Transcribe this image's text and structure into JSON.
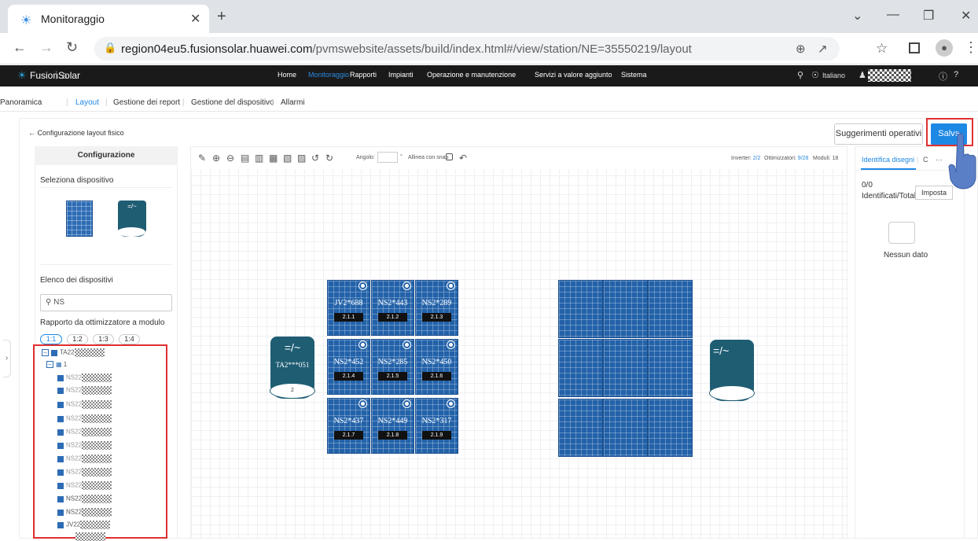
{
  "browser": {
    "tab_title": "Monitoraggio",
    "url_host": "region04eu5.fusionsolar.huawei.com",
    "url_path": "/pvmswebsite/assets/build/index.html#/view/station/NE=35550219/layout"
  },
  "header": {
    "logo": "FusionSolar",
    "nav": [
      "Home",
      "Monitoraggio",
      "Rapporti",
      "Impianti",
      "Operazione e manutenzione",
      "Servizi a valore aggiunto",
      "Sistema"
    ],
    "active_nav": "Monitoraggio",
    "language": "Italiano"
  },
  "subnav": [
    "Panoramica",
    "Layout",
    "Gestione dei report",
    "Gestione del dispositivo",
    "Allarmi"
  ],
  "back_link": "Configurazione layout fisico",
  "buttons": {
    "suggest": "Suggerimenti operativi",
    "save": "Salva"
  },
  "left_panel": {
    "title": "Configurazione",
    "select_device": "Seleziona dispositivo",
    "device_list": "Elenco dei dispositivi",
    "search_value": "NS",
    "ratio_label": "Rapporto da ottimizzatore a modulo",
    "ratios": [
      "1:1",
      "1:2",
      "1:3",
      "1:4"
    ],
    "tree_root": "TA22",
    "tree_group": "1",
    "tree_items": [
      "NS22",
      "NS22",
      "NS22",
      "NS22",
      "NS22",
      "NS22",
      "NS22",
      "NS22",
      "NS22",
      "NS22",
      "NS22",
      "JV22"
    ]
  },
  "canvas": {
    "angle_label": "Angolo:",
    "degree": "°",
    "snap_label": "Allinea con snap",
    "stats": {
      "inverter_label": "Inverter:",
      "inverter": "2/2",
      "opt_label": "Ottimizzatori:",
      "opt": "9/28",
      "mod_label": "Moduli:",
      "mod": "18"
    },
    "modules": [
      {
        "name": "JV2*688",
        "code": "2.1.1"
      },
      {
        "name": "NS2*443",
        "code": "2.1.2"
      },
      {
        "name": "NS2*289",
        "code": "2.1.3"
      },
      {
        "name": "NS2*452",
        "code": "2.1.4"
      },
      {
        "name": "NS2*285",
        "code": "2.1.5"
      },
      {
        "name": "NS2*450",
        "code": "2.1.6"
      },
      {
        "name": "NS2*437",
        "code": "2.1.7"
      },
      {
        "name": "NS2*449",
        "code": "2.1.8"
      },
      {
        "name": "NS2*317",
        "code": "2.1.9"
      }
    ],
    "inverter1": {
      "symbol": "=/~",
      "name": "TA2***051",
      "foot": "2"
    },
    "inverter2": {
      "symbol": "=/~"
    }
  },
  "right_panel": {
    "tab_active": "Identifica disegni",
    "tab_other": "C",
    "more": "···",
    "count": "0/0",
    "count_label": "Identificati/Totali",
    "tooltip": "Imposta",
    "empty": "Nessun dato"
  }
}
